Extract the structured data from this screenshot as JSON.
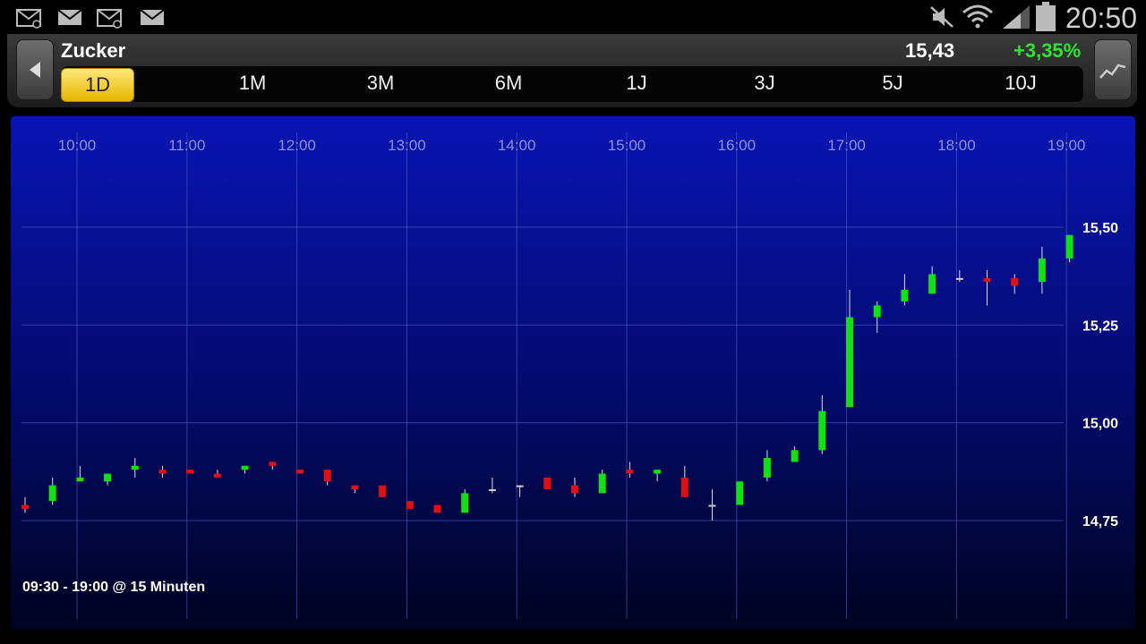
{
  "status_bar": {
    "time": "20:50",
    "notifications": [
      "mail-at-icon",
      "mail-icon",
      "mail-at-icon",
      "mail-icon"
    ],
    "indicators": [
      "mute-icon",
      "wifi-icon",
      "signal-icon",
      "battery-icon"
    ]
  },
  "header": {
    "title": "Zucker",
    "price": "15,43",
    "change": "+3,35%",
    "change_color": "#33e133",
    "periods": [
      "1D",
      "1M",
      "3M",
      "6M",
      "1J",
      "3J",
      "5J",
      "10J"
    ],
    "active_period": "1D"
  },
  "footer_note": "09:30 - 19:00 @ 15 Minuten",
  "chart_data": {
    "type": "candlestick",
    "x_tick_labels": [
      "10:00",
      "11:00",
      "12:00",
      "13:00",
      "14:00",
      "15:00",
      "16:00",
      "17:00",
      "18:00",
      "19:00"
    ],
    "y_tick_labels": [
      "15,50",
      "15,25",
      "15,00",
      "14,75"
    ],
    "y_ticks": [
      15.5,
      15.25,
      15.0,
      14.75
    ],
    "ylim": [
      14.5,
      15.79
    ],
    "up_color": "#13e013",
    "down_color": "#e01010",
    "grid": true,
    "candles": [
      {
        "time": "09:30",
        "open": 14.79,
        "high": 14.81,
        "low": 14.77,
        "close": 14.78
      },
      {
        "time": "09:45",
        "open": 14.8,
        "high": 14.86,
        "low": 14.79,
        "close": 14.84
      },
      {
        "time": "10:00",
        "open": 14.85,
        "high": 14.89,
        "low": 14.85,
        "close": 14.86
      },
      {
        "time": "10:15",
        "open": 14.85,
        "high": 14.87,
        "low": 14.84,
        "close": 14.87
      },
      {
        "time": "10:30",
        "open": 14.88,
        "high": 14.91,
        "low": 14.86,
        "close": 14.89
      },
      {
        "time": "10:45",
        "open": 14.88,
        "high": 14.89,
        "low": 14.86,
        "close": 14.87
      },
      {
        "time": "11:00",
        "open": 14.88,
        "high": 14.88,
        "low": 14.87,
        "close": 14.87
      },
      {
        "time": "11:15",
        "open": 14.87,
        "high": 14.88,
        "low": 14.86,
        "close": 14.86
      },
      {
        "time": "11:30",
        "open": 14.88,
        "high": 14.89,
        "low": 14.87,
        "close": 14.89
      },
      {
        "time": "11:45",
        "open": 14.9,
        "high": 14.9,
        "low": 14.88,
        "close": 14.89
      },
      {
        "time": "12:00",
        "open": 14.88,
        "high": 14.88,
        "low": 14.87,
        "close": 14.87
      },
      {
        "time": "12:15",
        "open": 14.88,
        "high": 14.88,
        "low": 14.84,
        "close": 14.85
      },
      {
        "time": "12:30",
        "open": 14.84,
        "high": 14.84,
        "low": 14.82,
        "close": 14.83
      },
      {
        "time": "12:45",
        "open": 14.84,
        "high": 14.84,
        "low": 14.81,
        "close": 14.81
      },
      {
        "time": "13:00",
        "open": 14.8,
        "high": 14.8,
        "low": 14.78,
        "close": 14.78
      },
      {
        "time": "13:15",
        "open": 14.79,
        "high": 14.79,
        "low": 14.77,
        "close": 14.77
      },
      {
        "time": "13:30",
        "open": 14.77,
        "high": 14.83,
        "low": 14.77,
        "close": 14.82
      },
      {
        "time": "13:45",
        "open": 14.83,
        "high": 14.86,
        "low": 14.82,
        "close": 14.83
      },
      {
        "time": "14:00",
        "open": 14.84,
        "high": 14.84,
        "low": 14.81,
        "close": 14.84
      },
      {
        "time": "14:15",
        "open": 14.86,
        "high": 14.86,
        "low": 14.83,
        "close": 14.83
      },
      {
        "time": "14:30",
        "open": 14.84,
        "high": 14.86,
        "low": 14.81,
        "close": 14.82
      },
      {
        "time": "14:45",
        "open": 14.82,
        "high": 14.88,
        "low": 14.82,
        "close": 14.87
      },
      {
        "time": "15:00",
        "open": 14.88,
        "high": 14.9,
        "low": 14.86,
        "close": 14.87
      },
      {
        "time": "15:15",
        "open": 14.87,
        "high": 14.88,
        "low": 14.85,
        "close": 14.88
      },
      {
        "time": "15:30",
        "open": 14.86,
        "high": 14.89,
        "low": 14.81,
        "close": 14.81
      },
      {
        "time": "15:45",
        "open": 14.79,
        "high": 14.83,
        "low": 14.75,
        "close": 14.79
      },
      {
        "time": "16:00",
        "open": 14.79,
        "high": 14.85,
        "low": 14.79,
        "close": 14.85
      },
      {
        "time": "16:15",
        "open": 14.86,
        "high": 14.93,
        "low": 14.85,
        "close": 14.91
      },
      {
        "time": "16:30",
        "open": 14.9,
        "high": 14.94,
        "low": 14.9,
        "close": 14.93
      },
      {
        "time": "16:45",
        "open": 14.93,
        "high": 15.07,
        "low": 14.92,
        "close": 15.03
      },
      {
        "time": "17:00",
        "open": 15.04,
        "high": 15.34,
        "low": 15.04,
        "close": 15.27
      },
      {
        "time": "17:15",
        "open": 15.27,
        "high": 15.31,
        "low": 15.23,
        "close": 15.3
      },
      {
        "time": "17:30",
        "open": 15.31,
        "high": 15.38,
        "low": 15.3,
        "close": 15.34
      },
      {
        "time": "17:45",
        "open": 15.33,
        "high": 15.4,
        "low": 15.33,
        "close": 15.38
      },
      {
        "time": "18:00",
        "open": 15.37,
        "high": 15.39,
        "low": 15.36,
        "close": 15.37
      },
      {
        "time": "18:15",
        "open": 15.37,
        "high": 15.39,
        "low": 15.3,
        "close": 15.36
      },
      {
        "time": "18:30",
        "open": 15.37,
        "high": 15.38,
        "low": 15.33,
        "close": 15.35
      },
      {
        "time": "18:45",
        "open": 15.36,
        "high": 15.45,
        "low": 15.33,
        "close": 15.42
      },
      {
        "time": "19:00",
        "open": 15.42,
        "high": 15.48,
        "low": 15.41,
        "close": 15.48
      }
    ]
  }
}
